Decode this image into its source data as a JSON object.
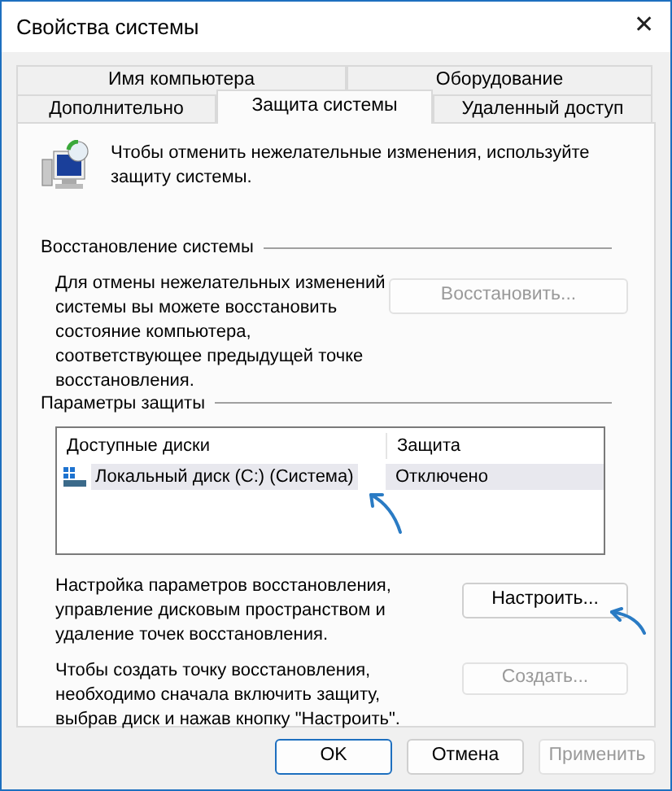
{
  "window": {
    "title": "Свойства системы",
    "close": "✕"
  },
  "tab_rows": [
    {
      "tabs": [
        {
          "label": "Имя компьютера",
          "selected": false
        },
        {
          "label": "Оборудование",
          "selected": false
        }
      ]
    },
    {
      "tabs": [
        {
          "label": "Дополнительно",
          "selected": false
        },
        {
          "label": "Защита системы",
          "selected": true
        },
        {
          "label": "Удаленный доступ",
          "selected": false
        }
      ]
    }
  ],
  "intro": "Чтобы отменить нежелательные изменения, используйте защиту системы.",
  "system_restore": {
    "title": "Восстановление системы",
    "description": "Для отмены нежелательных изменений системы вы можете восстановить состояние компьютера, соответствующее предыдущей точке восстановления.",
    "button": {
      "label": "Восстановить...",
      "disabled": true
    }
  },
  "protection": {
    "title": "Параметры защиты",
    "columns": [
      "Доступные диски",
      "Защита"
    ],
    "drives": [
      {
        "name": "Локальный диск (C:) (Система)",
        "protection": "Отключено",
        "selected": true
      }
    ],
    "actions": [
      {
        "description": "Настройка параметров восстановления, управление дисковым пространством и удаление точек восстановления.",
        "button": {
          "label": "Настроить...",
          "disabled": false
        }
      },
      {
        "description": "Чтобы создать точку восстановления, необходимо сначала включить защиту, выбрав диск и нажав кнопку \"Настроить\".",
        "button": {
          "label": "Создать...",
          "disabled": true
        }
      }
    ]
  },
  "buttons": [
    {
      "label": "OK",
      "default": true,
      "disabled": false
    },
    {
      "label": "Отмена",
      "default": false,
      "disabled": false
    },
    {
      "label": "Применить",
      "default": false,
      "disabled": true
    }
  ]
}
